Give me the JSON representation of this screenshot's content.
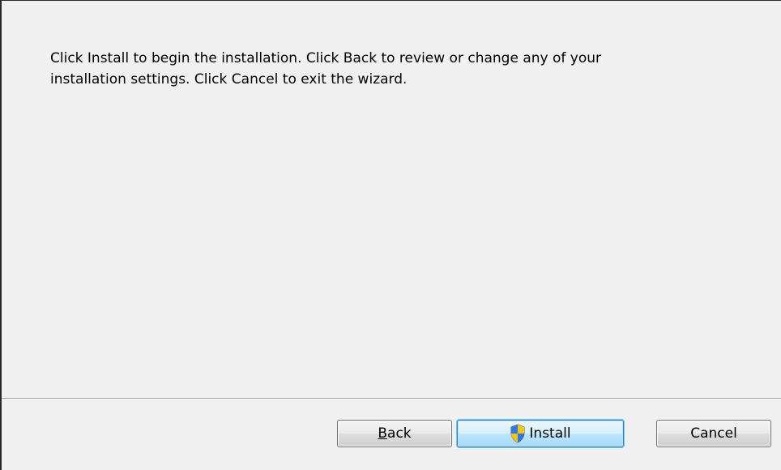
{
  "message": {
    "line1": "Click Install to begin the installation. Click Back to review or change any of your",
    "line2": "installation settings. Click Cancel to exit the wizard."
  },
  "buttons": {
    "back": {
      "mnemonic": "B",
      "rest": "ack"
    },
    "install": {
      "label": "Install",
      "icon": "uac-shield-icon"
    },
    "cancel": {
      "label": "Cancel"
    }
  },
  "colors": {
    "dialog_background": "#f0f0f0",
    "default_button_border": "#3c7fb1"
  }
}
